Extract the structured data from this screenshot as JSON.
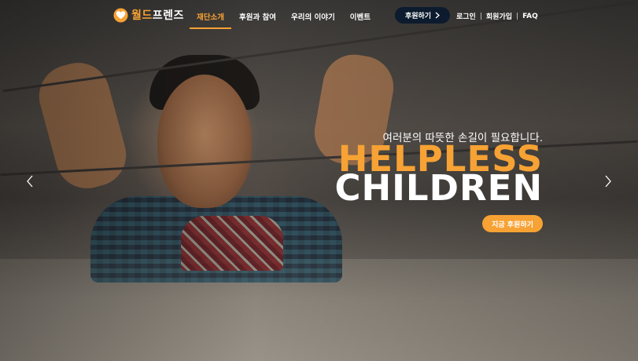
{
  "brand": {
    "name_part1": "월드",
    "name_part2": "프렌즈"
  },
  "nav": {
    "items": [
      {
        "label": "재단소개",
        "active": true
      },
      {
        "label": "후원과 참여",
        "active": false
      },
      {
        "label": "우리의 이야기",
        "active": false
      },
      {
        "label": "이벤트",
        "active": false
      }
    ],
    "donate_label": "후원하기",
    "login": "로그인",
    "signup": "회원가입",
    "faq": "FAQ"
  },
  "hero": {
    "subtitle": "여러분의 따뜻한 손길이 필요합니다.",
    "headline_1": "HELPLESS",
    "headline_2": "CHILDREN",
    "cta_label": "지금 후원하기"
  },
  "colors": {
    "accent": "#f7a234",
    "navy": "#0d1b2e"
  },
  "icons": {
    "logo": "hands-heart-icon",
    "prev": "chevron-left-icon",
    "next": "chevron-right-icon",
    "donate_arrow": "chevron-right-icon"
  }
}
